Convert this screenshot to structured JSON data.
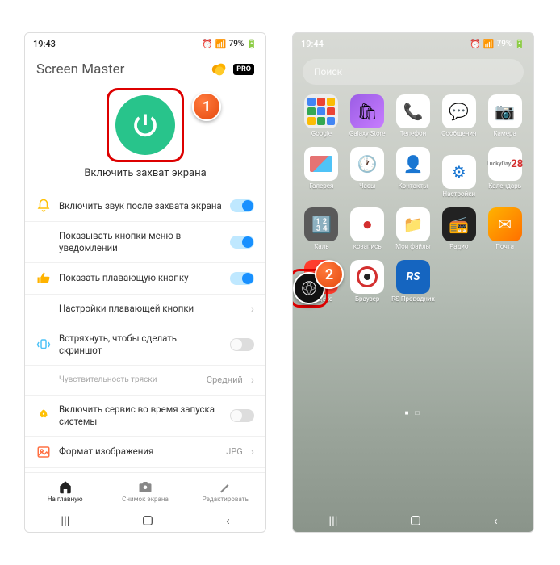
{
  "left": {
    "status": {
      "time": "19:43",
      "battery": "79%"
    },
    "app_title": "Screen Master",
    "pro_label": "PRO",
    "capture_label": "Включить захват экрана",
    "rows": {
      "sound": "Включить звук после захвата экрана",
      "menu_buttons": "Показывать кнопки меню в уведомлении",
      "floating": "Показать плавающую кнопку",
      "floating_settings": "Настройки плавающей кнопки",
      "shake": "Встряхнуть, чтобы сделать скриншот",
      "sensitivity_label": "Чувствительность тряски",
      "sensitivity_value": "Средний",
      "boot": "Включить сервис во время запуска системы",
      "format_label": "Формат изображения",
      "format_value": "JPG"
    },
    "tabs": {
      "home": "На главную",
      "screenshot": "Снимок экрана",
      "edit": "Редактировать"
    }
  },
  "right": {
    "status": {
      "time": "19:44",
      "battery": "79%"
    },
    "search_placeholder": "Поиск",
    "apps": {
      "google": "Google",
      "galaxy": "Galaxy Store",
      "phone": "Телефон",
      "messages": "Сообщения",
      "camera": "Камера",
      "gallery": "Галерея",
      "clock": "Часы",
      "contacts": "Контакты",
      "settings": "Настройки",
      "calendar": "Календарь",
      "calendar_day": "28",
      "calc": "Каль",
      "recorder": "козапись",
      "files": "Мои файлы",
      "radio": "Радио",
      "mail": "Почта",
      "yandex": "Яндекс",
      "browser": "Браузер",
      "rs": "RS Проводник"
    }
  },
  "callouts": {
    "one": "1",
    "two": "2"
  }
}
